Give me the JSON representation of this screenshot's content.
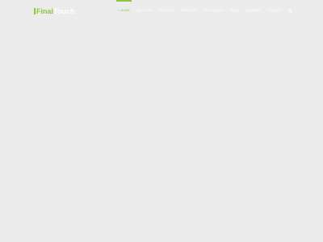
{
  "logo": {
    "part_a": "Final",
    "part_b": "Touch"
  },
  "nav": {
    "home_icon": "home-icon",
    "items": [
      {
        "label": "HOME"
      },
      {
        "label": "ABOUT US"
      },
      {
        "label": "SERVICES"
      },
      {
        "label": "PROJECTS"
      },
      {
        "label": "OUR CLIENTS"
      },
      {
        "label": "BLOG"
      },
      {
        "label": "CAREERS"
      },
      {
        "label": "CONTACT"
      }
    ],
    "search_icon": "search-icon"
  },
  "colors": {
    "accent": "#8cc63f",
    "background": "#ececec",
    "nav_text": "#ffffff"
  }
}
